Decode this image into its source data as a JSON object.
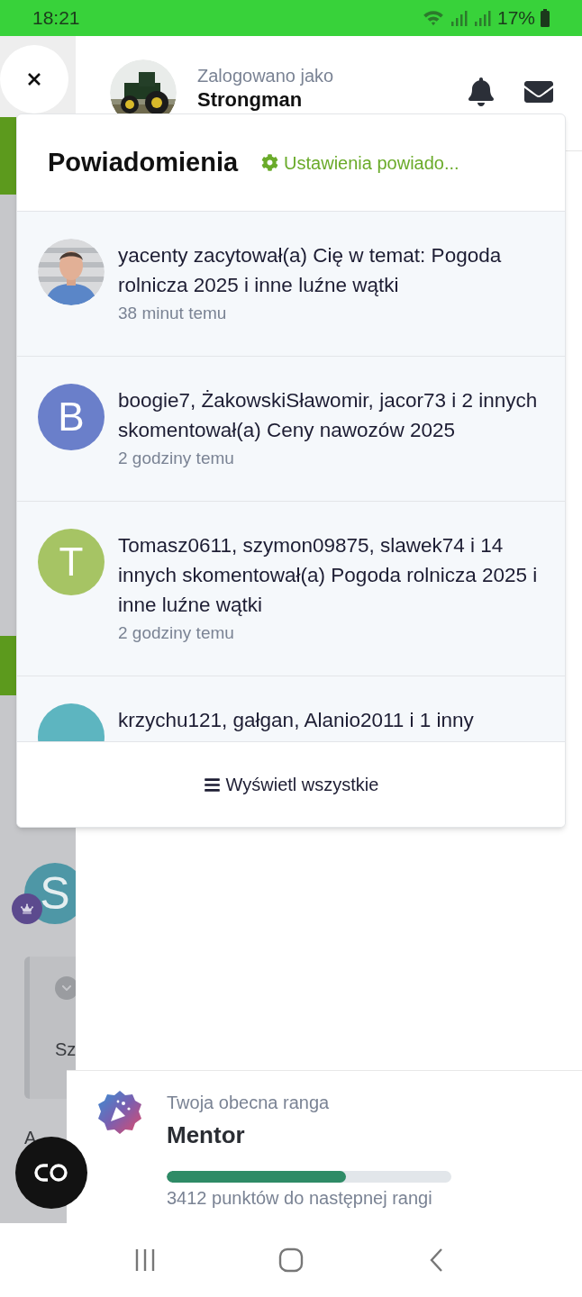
{
  "status_bar": {
    "time": "18:21",
    "battery": "17%"
  },
  "background": {
    "avatar_letter": "S",
    "card_text": "Sz",
    "text": "A"
  },
  "drawer": {
    "label": "Zalogowano jako",
    "username": "Strongman"
  },
  "notifications": {
    "title": "Powiadomienia",
    "settings_link": "Ustawienia powiado...",
    "items": [
      {
        "text": "yacenty zacytował(a) Cię w temat: Pogoda rolnicza 2025 i inne luźne wątki",
        "time": "38 minut temu"
      },
      {
        "kind": "letter",
        "letter": "B",
        "color": "#6a7fca",
        "text": "boogie7, ŻakowskiSławomir, jacor73 i 2 innych skomentował(a) Ceny nawozów 2025",
        "time": "2 godziny temu"
      },
      {
        "kind": "letter",
        "letter": "T",
        "color": "#a6c464",
        "text": "Tomasz0611, szymon09875, slawek74 i 14 innych skomentował(a) Pogoda rolnicza 2025 i inne luźne wątki",
        "time": "2 godziny temu"
      },
      {
        "kind": "letter",
        "color": "#5db5c0",
        "text": "krzychu121, gałgan, Alanio2011 i 1 inny"
      }
    ],
    "footer": "Wyświetl wszystkie"
  },
  "rank": {
    "label": "Twoja obecna ranga",
    "name": "Mentor",
    "level": 0.63,
    "caption": "3412 punktów do następnej rangi"
  }
}
